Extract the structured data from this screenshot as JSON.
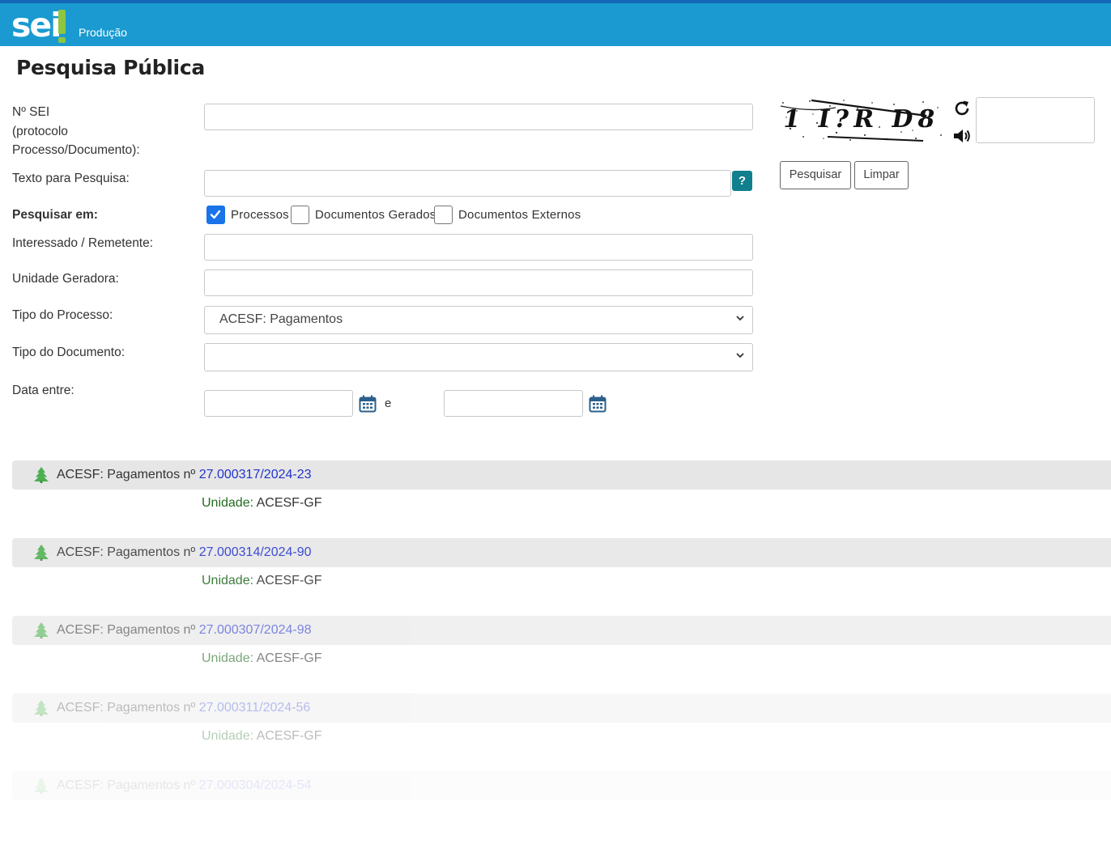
{
  "header": {
    "logo_text": "sei",
    "environment": "Produção",
    "colors": {
      "bar": "#1a9ad0",
      "accent": "#8dc63f"
    }
  },
  "page": {
    "title": "Pesquisa Pública"
  },
  "form": {
    "protocolo_label_1": "Nº SEI",
    "protocolo_label_2": "(protocolo",
    "protocolo_label_3": "Processo/Documento):",
    "texto_label": "Texto para Pesquisa:",
    "help_label": "?",
    "pesquisar_em_label": "Pesquisar em:",
    "options": [
      {
        "label": "Processos",
        "checked": true
      },
      {
        "label": "Documentos Gerados",
        "checked": false
      },
      {
        "label": "Documentos Externos",
        "checked": false
      }
    ],
    "interessado_label": "Interessado / Remetente:",
    "unidade_label": "Unidade Geradora:",
    "tipo_processo_label": "Tipo do Processo:",
    "tipo_processo_value": "ACESF: Pagamentos",
    "tipo_documento_label": "Tipo do Documento:",
    "tipo_documento_value": "",
    "data_label": "Data entre:",
    "data_sep": "e"
  },
  "captcha": {
    "text": "1 I?R D8",
    "refresh_icon": "refresh-icon",
    "audio_icon": "speaker-icon"
  },
  "buttons": {
    "search": "Pesquisar",
    "clear": "Limpar"
  },
  "results": [
    {
      "title": "ACESF: Pagamentos nº",
      "protocol": "27.000317/2024-23",
      "unit_label": "Unidade:",
      "unit": "ACESF-GF",
      "opacity": 1
    },
    {
      "title": "ACESF: Pagamentos nº",
      "protocol": "27.000314/2024-90",
      "unit_label": "Unidade:",
      "unit": "ACESF-GF",
      "opacity": 0.88
    },
    {
      "title": "ACESF: Pagamentos nº",
      "protocol": "27.000307/2024-98",
      "unit_label": "Unidade:",
      "unit": "ACESF-GF",
      "opacity": 0.6
    },
    {
      "title": "ACESF: Pagamentos nº",
      "protocol": "27.000311/2024-56",
      "unit_label": "Unidade:",
      "unit": "ACESF-GF",
      "opacity": 0.33
    },
    {
      "title": "ACESF: Pagamentos nº",
      "protocol": "27.000304/2024-54",
      "unit_label": "",
      "unit": "",
      "opacity": 0.12
    }
  ]
}
